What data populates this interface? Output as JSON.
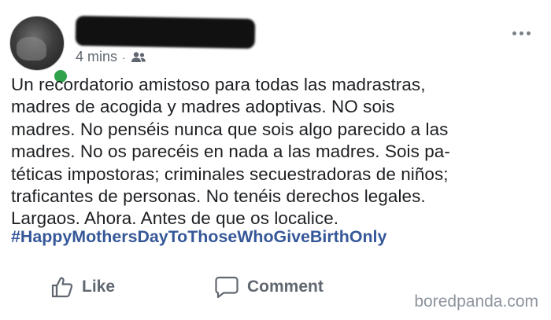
{
  "post": {
    "author_name": "",
    "timestamp": "4 mins",
    "separator": "·",
    "audience_icon": "friends-icon",
    "body_lines": [
      "Un recordatorio amistoso para todas las madrastras,",
      "madres de acogida y madres adoptivas. NO sois",
      "madres. No penséis nunca que sois algo parecido a las",
      "madres. No os parecéis en nada a las madres. Sois pa-",
      "téticas impostoras; criminales secuestradoras de niños;",
      "traficantes de personas. No tenéis derechos legales.",
      "Largaos. Ahora. Antes de que os localice."
    ],
    "hashtag": "#HappyMothersDayToThoseWhoGiveBirthOnly"
  },
  "actions": {
    "like_label": "Like",
    "comment_label": "Comment"
  },
  "watermark": "boredpanda.com",
  "colors": {
    "online": "#31a24c",
    "hashtag": "#365899",
    "meta_text": "#606770"
  }
}
